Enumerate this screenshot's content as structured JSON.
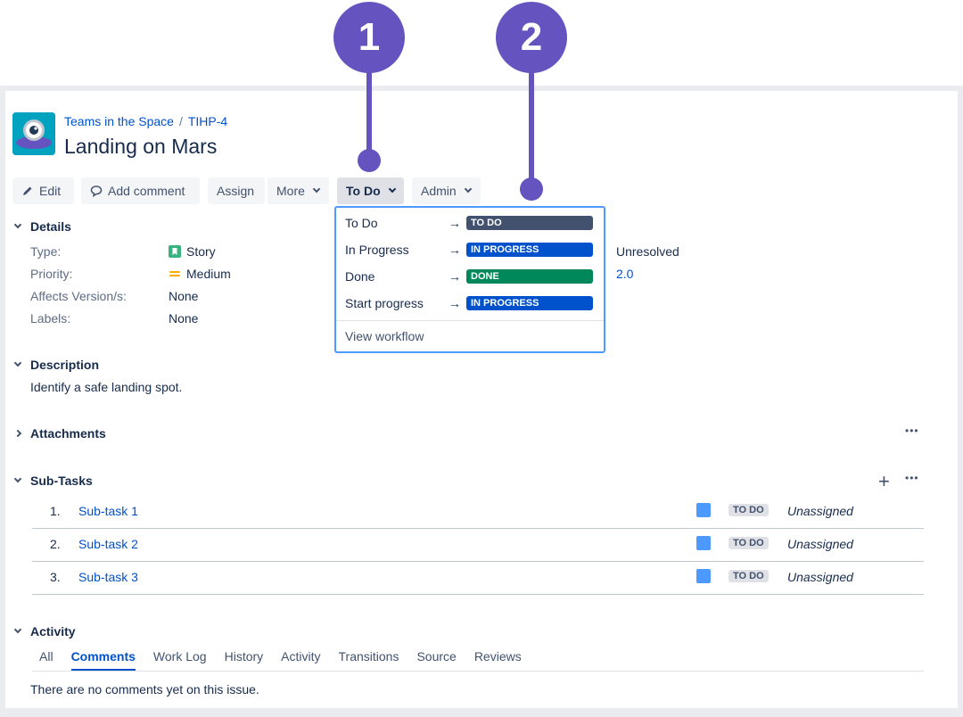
{
  "callouts": [
    "1",
    "2"
  ],
  "breadcrumb": {
    "project": "Teams in the Space",
    "separator": "/",
    "issue_key": "TIHP-4"
  },
  "issue": {
    "title": "Landing on Mars"
  },
  "toolbar": {
    "edit": "Edit",
    "add_comment": "Add comment",
    "assign": "Assign",
    "more": "More",
    "status": "To Do",
    "admin": "Admin"
  },
  "details": {
    "heading": "Details",
    "fields": [
      {
        "label": "Type:",
        "value": "Story"
      },
      {
        "label": "Priority:",
        "value": "Medium"
      },
      {
        "label": "Affects Version/s:",
        "value": "None"
      },
      {
        "label": "Labels:",
        "value": "None"
      }
    ],
    "right_values": [
      "Unresolved",
      "2.0"
    ]
  },
  "transitions_menu": {
    "items": [
      {
        "label": "To Do",
        "arrow": "→",
        "status": "TO DO",
        "color": "#42526e"
      },
      {
        "label": "In Progress",
        "arrow": "→",
        "status": "IN PROGRESS",
        "color": "#0052cc"
      },
      {
        "label": "Done",
        "arrow": "→",
        "status": "DONE",
        "color": "#00875a"
      },
      {
        "label": "Start progress",
        "arrow": "→",
        "status": "IN PROGRESS",
        "color": "#0052cc"
      }
    ],
    "footer": "View workflow"
  },
  "description": {
    "heading": "Description",
    "text": "Identify a safe landing spot."
  },
  "attachments": {
    "heading": "Attachments",
    "more": "•••"
  },
  "subtasks": {
    "heading": "Sub-Tasks",
    "add": "+",
    "more": "•••",
    "rows": [
      {
        "num": "1.",
        "name": "Sub-task 1",
        "status": "TO DO",
        "assignee": "Unassigned"
      },
      {
        "num": "2.",
        "name": "Sub-task 2",
        "status": "TO DO",
        "assignee": "Unassigned"
      },
      {
        "num": "3.",
        "name": "Sub-task 3",
        "status": "TO DO",
        "assignee": "Unassigned"
      }
    ]
  },
  "activity": {
    "heading": "Activity",
    "tabs": [
      "All",
      "Comments",
      "Work Log",
      "History",
      "Activity",
      "Transitions",
      "Source",
      "Reviews"
    ],
    "active_tab": "Comments",
    "empty_text": "There are no comments yet on this issue."
  }
}
